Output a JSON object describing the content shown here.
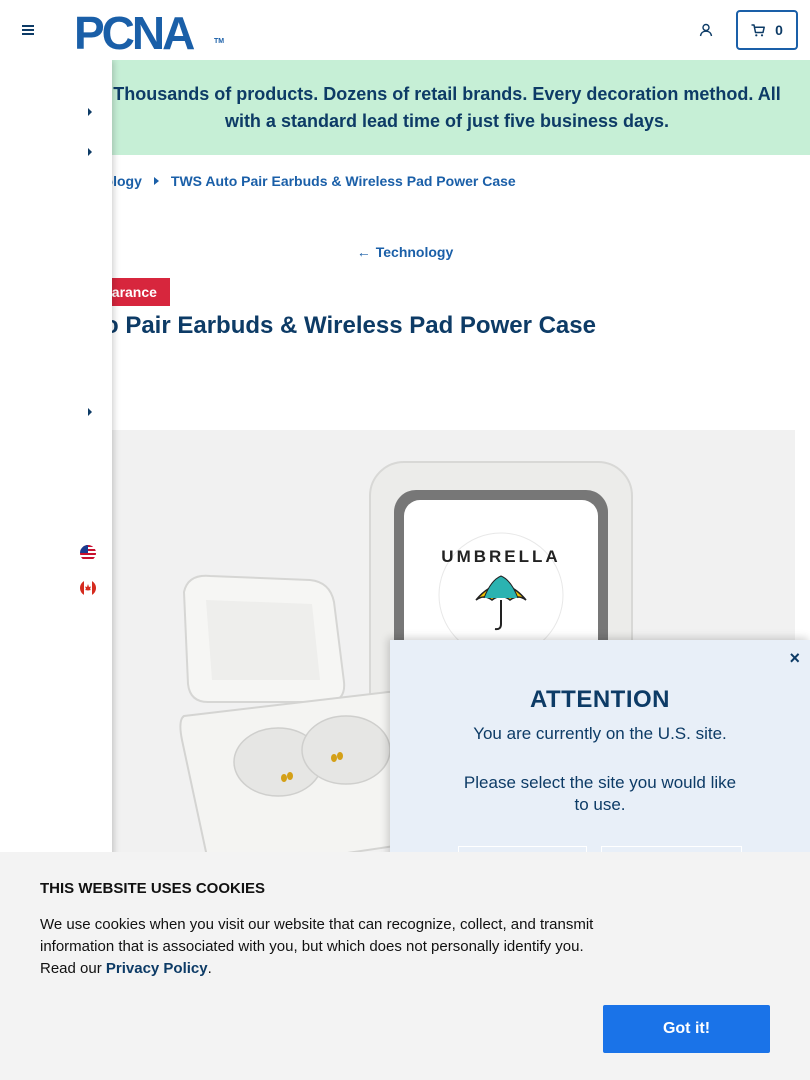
{
  "header": {
    "logo_text": "PCNA",
    "logo_tm": "TM",
    "cart_count": "0"
  },
  "banner": {
    "text": "Thousands of products. Dozens of retail brands. Every decoration method. All with a standard lead time of just five business days."
  },
  "breadcrumb": {
    "parent": "nology",
    "current": "TWS Auto Pair Earbuds & Wireless Pad Power Case"
  },
  "back_link": {
    "arrow": "←",
    "label": "Technology"
  },
  "badge": {
    "label": "earance"
  },
  "product": {
    "title": "to Pair Earbuds & Wireless Pad Power Case",
    "image_brand_text": "UMBRELLA STUDIOS"
  },
  "modal": {
    "close": "×",
    "title": "ATTENTION",
    "line1": "You are currently on the U.S. site.",
    "line2": "Please select the site you would like to use."
  },
  "cookie": {
    "title": "THIS WEBSITE USES COOKIES",
    "text_before": "We use cookies when you visit our website that can recognize, collect, and transmit information that is associated with you, but which does not personally identify you. Read our ",
    "link": "Privacy Policy",
    "text_after": ".",
    "button": "Got it!"
  },
  "colors": {
    "brand": "#1a5fa8",
    "navy": "#0d3b66",
    "banner_bg": "#c6efd6",
    "badge_bg": "#d7263d",
    "cookie_button": "#1a73e8"
  }
}
